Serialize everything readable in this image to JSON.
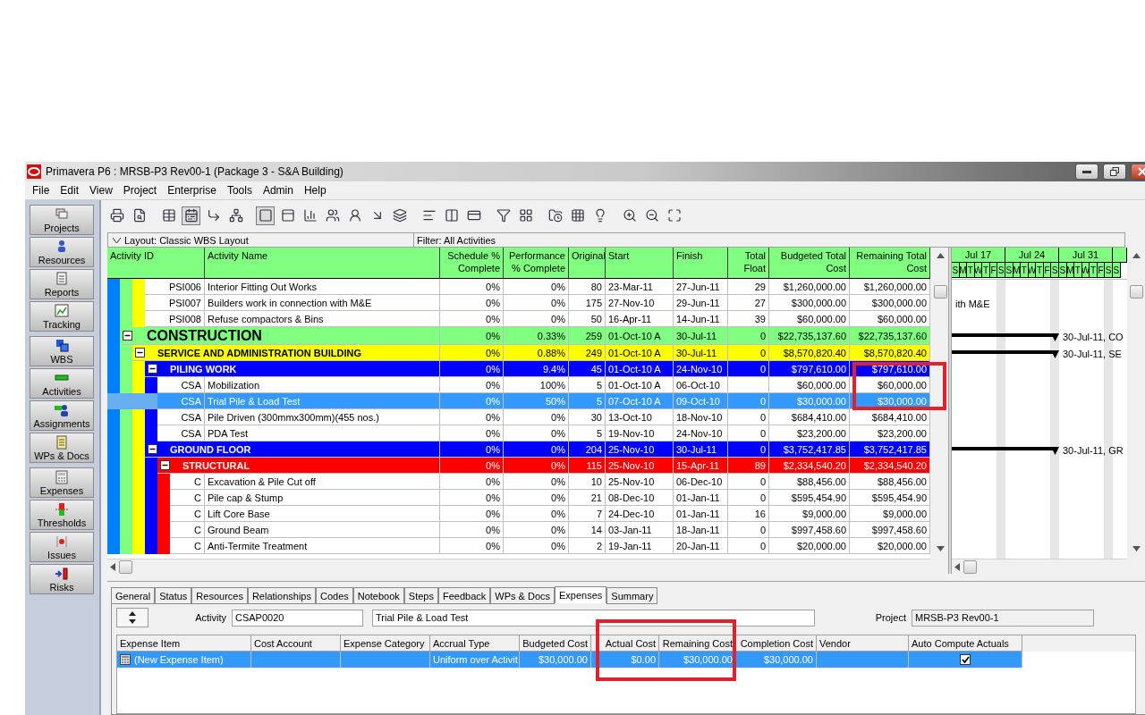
{
  "window": {
    "title": "Primavera P6 : MRSB-P3 Rev00-1 (Package 3 - S&A Building)"
  },
  "menu": [
    "File",
    "Edit",
    "View",
    "Project",
    "Enterprise",
    "Tools",
    "Admin",
    "Help"
  ],
  "sidebar": {
    "groups": [
      [
        {
          "label": "Projects"
        },
        {
          "label": "Resources"
        },
        {
          "label": "Reports"
        },
        {
          "label": "Tracking"
        }
      ],
      [
        {
          "label": "WBS"
        },
        {
          "label": "Activities"
        },
        {
          "label": "Assignments"
        },
        {
          "label": "WPs & Docs"
        }
      ],
      [
        {
          "label": "Expenses"
        },
        {
          "label": "Thresholds"
        },
        {
          "label": "Issues"
        },
        {
          "label": "Risks"
        }
      ]
    ]
  },
  "toolbar": [
    [
      {
        "selected": false
      },
      {
        "selected": false
      }
    ],
    [
      {
        "selected": false
      },
      {
        "selected": true
      },
      {
        "selected": false
      },
      {
        "selected": false
      }
    ],
    [
      {
        "selected": true
      },
      {
        "selected": false
      },
      {
        "selected": false
      },
      {
        "selected": false
      },
      {
        "selected": false
      },
      {
        "selected": false
      },
      {
        "selected": false
      }
    ],
    [
      {
        "selected": false
      },
      {
        "selected": false
      },
      {
        "selected": false
      }
    ],
    [
      {
        "selected": false
      },
      {
        "selected": false
      }
    ],
    [
      {
        "selected": false
      },
      {
        "selected": false
      },
      {
        "selected": false
      }
    ],
    [
      {
        "selected": false
      },
      {
        "selected": false
      },
      {
        "selected": false
      }
    ]
  ],
  "layout_bar": {
    "layout": "Layout: Classic WBS Layout",
    "filter": "Filter: All Activities"
  },
  "table": {
    "columns": [
      "Activity ID",
      "Activity Name",
      "Schedule % Complete",
      "Performance % Complete",
      "Original",
      "Start",
      "Finish",
      "Total Float",
      "Budgeted Total Cost",
      "Remaining Total Cost"
    ],
    "rows": [
      {
        "kind": "wbs_band",
        "color": "#0080ff",
        "children": [
          {
            "kind": "wbs_band",
            "color": "#80ff80",
            "children": [
              {
                "kind": "wbs_band",
                "color": "#ffff00",
                "children": [
                  {
                    "kind": "activity",
                    "selected": false,
                    "id": "PSI006",
                    "name": "Interior Fitting Out Works",
                    "schedule_pct": "0%",
                    "performance_pct": "0%",
                    "original_duration": "80",
                    "start": "23-Mar-11",
                    "finish": "27-Jun-11",
                    "total_float": "29",
                    "budgeted_total_cost": "$1,260,000.00",
                    "remaining_total_cost": "$1,260,000.00"
                  },
                  {
                    "kind": "activity",
                    "selected": false,
                    "id": "PSI007",
                    "name": "Builders work in connection with M&E",
                    "schedule_pct": "0%",
                    "performance_pct": "0%",
                    "original_duration": "175",
                    "start": "27-Nov-10",
                    "finish": "29-Jun-11",
                    "total_float": "27",
                    "budgeted_total_cost": "$300,000.00",
                    "remaining_total_cost": "$300,000.00",
                    "gantt_bar": false,
                    "gantt_label": "ith M&E"
                  },
                  {
                    "kind": "activity",
                    "selected": false,
                    "id": "PSI008",
                    "name": "Refuse compactors & Bins",
                    "schedule_pct": "0%",
                    "performance_pct": "0%",
                    "original_duration": "50",
                    "start": "16-Apr-11",
                    "finish": "14-Jun-11",
                    "total_float": "39",
                    "budgeted_total_cost": "$60,000.00",
                    "remaining_total_cost": "$60,000.00"
                  }
                ]
              }
            ]
          },
          {
            "kind": "wbs",
            "expanded": true,
            "color": "#80ff80",
            "name": "CONSTRUCTION",
            "schedule_pct": "0%",
            "performance_pct": "0.33%",
            "original_duration": "259",
            "start": "01-Oct-10 A",
            "finish": "30-Jul-11",
            "total_float": "0",
            "budgeted_total_cost": "$22,735,137.60",
            "remaining_total_cost": "$22,735,137.60",
            "gantt_bar": true,
            "gantt_label": "30-Jul-11, CO",
            "children": [
              {
                "kind": "wbs",
                "expanded": true,
                "color": "#ffff00",
                "name": "SERVICE AND ADMINISTRATION BUILDING",
                "schedule_pct": "0%",
                "performance_pct": "0.88%",
                "original_duration": "249",
                "start": "01-Oct-10 A",
                "finish": "30-Jul-11",
                "total_float": "0",
                "budgeted_total_cost": "$8,570,820.40",
                "remaining_total_cost": "$8,570,820.40",
                "gantt_bar": true,
                "gantt_label": "30-Jul-11, SE",
                "children": [
                  {
                    "kind": "wbs",
                    "expanded": true,
                    "color": "#0000ff",
                    "name": "PILING WORK",
                    "schedule_pct": "0%",
                    "performance_pct": "9.4%",
                    "original_duration": "45",
                    "start": "01-Oct-10 A",
                    "finish": "24-Nov-10",
                    "total_float": "0",
                    "budgeted_total_cost": "$797,610.00",
                    "remaining_total_cost": "$797,610.00",
                    "children": [
                      {
                        "kind": "activity",
                        "selected": false,
                        "id": "CSA",
                        "name": "Mobilization",
                        "schedule_pct": "0%",
                        "performance_pct": "100%",
                        "original_duration": "5",
                        "start": "01-Oct-10 A",
                        "finish": "06-Oct-10",
                        "budgeted_total_cost": "$60,000.00",
                        "remaining_total_cost": "$60,000.00"
                      },
                      {
                        "kind": "activity",
                        "selected": true,
                        "id": "CSA",
                        "name": "Trial Pile & Load Test",
                        "schedule_pct": "0%",
                        "performance_pct": "50%",
                        "original_duration": "5",
                        "start": "07-Oct-10 A",
                        "finish": "09-Oct-10",
                        "total_float": "0",
                        "budgeted_total_cost": "$30,000.00",
                        "remaining_total_cost": "$30,000.00"
                      },
                      {
                        "kind": "activity",
                        "selected": false,
                        "id": "CSA",
                        "name": "Pile Driven (300mmx300mm)(455 nos.)",
                        "schedule_pct": "0%",
                        "performance_pct": "0%",
                        "original_duration": "30",
                        "start": "13-Oct-10",
                        "finish": "18-Nov-10",
                        "total_float": "0",
                        "budgeted_total_cost": "$684,410.00",
                        "remaining_total_cost": "$684,410.00"
                      },
                      {
                        "kind": "activity",
                        "selected": false,
                        "id": "CSA",
                        "name": "PDA Test",
                        "schedule_pct": "0%",
                        "performance_pct": "0%",
                        "original_duration": "5",
                        "start": "19-Nov-10",
                        "finish": "24-Nov-10",
                        "total_float": "0",
                        "budgeted_total_cost": "$23,200.00",
                        "remaining_total_cost": "$23,200.00"
                      }
                    ]
                  },
                  {
                    "kind": "wbs",
                    "expanded": true,
                    "color": "#0000ff",
                    "name": "GROUND FLOOR",
                    "schedule_pct": "0%",
                    "performance_pct": "0%",
                    "original_duration": "204",
                    "start": "25-Nov-10",
                    "finish": "30-Jul-11",
                    "total_float": "0",
                    "budgeted_total_cost": "$3,752,417.85",
                    "remaining_total_cost": "$3,752,417.85",
                    "gantt_bar": true,
                    "gantt_label": "30-Jul-11, GR",
                    "children": [
                      {
                        "kind": "wbs",
                        "expanded": true,
                        "color": "#ff0000",
                        "name": "STRUCTURAL",
                        "schedule_pct": "0%",
                        "performance_pct": "0%",
                        "original_duration": "115",
                        "start": "25-Nov-10",
                        "finish": "15-Apr-11",
                        "total_float": "89",
                        "budgeted_total_cost": "$2,334,540.20",
                        "remaining_total_cost": "$2,334,540.20",
                        "children": [
                          {
                            "kind": "activity",
                            "selected": false,
                            "id": "C",
                            "name": "Excavation & Pile Cut off",
                            "schedule_pct": "0%",
                            "performance_pct": "0%",
                            "original_duration": "10",
                            "start": "25-Nov-10",
                            "finish": "06-Dec-10",
                            "total_float": "0",
                            "budgeted_total_cost": "$88,456.00",
                            "remaining_total_cost": "$88,456.00"
                          },
                          {
                            "kind": "activity",
                            "selected": false,
                            "id": "C",
                            "name": "Pile cap & Stump",
                            "schedule_pct": "0%",
                            "performance_pct": "0%",
                            "original_duration": "21",
                            "start": "08-Dec-10",
                            "finish": "01-Jan-11",
                            "total_float": "0",
                            "budgeted_total_cost": "$595,454.90",
                            "remaining_total_cost": "$595,454.90"
                          },
                          {
                            "kind": "activity",
                            "selected": false,
                            "id": "C",
                            "name": "Lift Core Base",
                            "schedule_pct": "0%",
                            "performance_pct": "0%",
                            "original_duration": "7",
                            "start": "24-Dec-10",
                            "finish": "01-Jan-11",
                            "total_float": "16",
                            "budgeted_total_cost": "$9,000.00",
                            "remaining_total_cost": "$9,000.00"
                          },
                          {
                            "kind": "activity",
                            "selected": false,
                            "id": "C",
                            "name": "Ground Beam",
                            "schedule_pct": "0%",
                            "performance_pct": "0%",
                            "original_duration": "14",
                            "start": "03-Jan-11",
                            "finish": "18-Jan-11",
                            "total_float": "0",
                            "budgeted_total_cost": "$997,458.60",
                            "remaining_total_cost": "$997,458.60"
                          },
                          {
                            "kind": "activity",
                            "selected": false,
                            "id": "C",
                            "name": "Anti-Termite Treatment",
                            "schedule_pct": "0%",
                            "performance_pct": "0%",
                            "original_duration": "2",
                            "start": "19-Jan-11",
                            "finish": "20-Jan-11",
                            "total_float": "0",
                            "budgeted_total_cost": "$20,000.00",
                            "remaining_total_cost": "$20,000.00"
                          }
                        ]
                      }
                    ]
                  }
                ]
              }
            ]
          }
        ]
      }
    ]
  },
  "gantt": {
    "weeks": [
      {
        "label": "Jul 17",
        "days": [
          "S",
          "M",
          "T",
          "W",
          "T",
          "F",
          "S"
        ]
      },
      {
        "label": "Jul 24",
        "days": [
          "S",
          "M",
          "T",
          "W",
          "T",
          "F",
          "S"
        ]
      },
      {
        "label": "Jul 31",
        "days": [
          "S",
          "M",
          "T",
          "W",
          "T",
          "F",
          "S"
        ]
      },
      {
        "days": [
          "S"
        ]
      }
    ]
  },
  "details": {
    "tabs": [
      {
        "label": "General",
        "selected": false
      },
      {
        "label": "Status",
        "selected": false
      },
      {
        "label": "Resources",
        "selected": false
      },
      {
        "label": "Relationships",
        "selected": false
      },
      {
        "label": "Codes",
        "selected": false
      },
      {
        "label": "Notebook",
        "selected": false
      },
      {
        "label": "Steps",
        "selected": false
      },
      {
        "label": "Feedback",
        "selected": false
      },
      {
        "label": "WPs & Docs",
        "selected": false
      },
      {
        "label": "Expenses",
        "selected": true
      },
      {
        "label": "Summary",
        "selected": false
      }
    ],
    "activity": {
      "label": "Activity",
      "id": "CSAP0020",
      "name": "Trial Pile & Load Test"
    },
    "project": {
      "label": "Project",
      "value": "MRSB-P3 Rev00-1"
    },
    "expenses": {
      "columns": [
        "Expense Item",
        "Cost Account",
        "Expense Category",
        "Accrual Type",
        "Budgeted Cost",
        "Actual Cost",
        "Remaining Cost",
        "Completion Cost",
        "Vendor",
        "Auto Compute Actuals"
      ],
      "rows": [
        {
          "selected": true,
          "expense_item": "(New Expense Item)",
          "accrual_type": "Uniform over Activit",
          "budgeted_cost": "$30,000.00",
          "actual_cost": "$0.00",
          "remaining_cost": "$30,000.00",
          "completion_cost": "$30,000.00",
          "auto_compute_actuals": true
        }
      ]
    }
  }
}
